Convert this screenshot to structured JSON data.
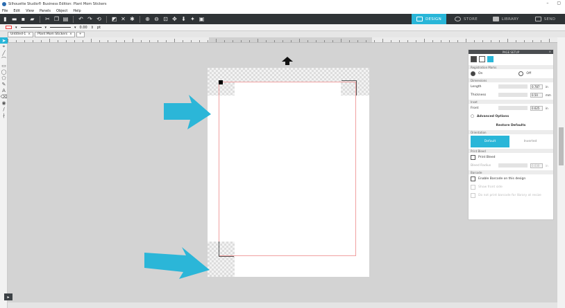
{
  "window": {
    "title": "Silhouette Studio® Business Edition: Plant Mom Stickers",
    "min": "–",
    "max": "▢",
    "close": "✕"
  },
  "menu": [
    "File",
    "Edit",
    "View",
    "Panels",
    "Object",
    "Help"
  ],
  "nav_tabs": [
    {
      "label": "DESIGN",
      "icon": "design-icon",
      "active": true
    },
    {
      "label": "STORE",
      "icon": "store-icon",
      "active": false
    },
    {
      "label": "LIBRARY",
      "icon": "library-icon",
      "active": false
    },
    {
      "label": "SEND",
      "icon": "send-icon",
      "active": false
    }
  ],
  "options_bar": {
    "line_width": "0.00",
    "unit": "pt"
  },
  "doc_tabs": [
    "Untitled-1",
    "Plant Mom Stickers"
  ],
  "page_setup": {
    "title": "PAGE SETUP",
    "sections": {
      "registration": "Registration Marks",
      "dimensions": "Dimensions",
      "inset": "Inset",
      "orientation": "Orientation",
      "print_bleed": "Print Bleed",
      "barcode": "Barcode"
    },
    "reg_on": "On",
    "reg_off": "Off",
    "length_label": "Length",
    "length_value": "0.787",
    "length_unit": "in",
    "thickness_label": "Thickness",
    "thickness_value": "0.50",
    "thickness_unit": "mm",
    "front_label": "Front",
    "front_value": "0.625",
    "front_unit": "in",
    "advanced": "Advanced Options",
    "restore": "Restore Defaults",
    "orient_default": "Default",
    "orient_inverted": "Inverted",
    "print_bleed_label": "Print Bleed",
    "bleed_radius_label": "Bleed Radius",
    "bleed_radius_value": "0.030",
    "bleed_radius_unit": "in",
    "barcode_enable": "Enable Barcode on this design",
    "barcode_both": "Show front side",
    "barcode_ex": "Do not print barcode for library at resize"
  },
  "colors": {
    "accent": "#29b6d8",
    "toolbar": "#2f3336",
    "cut_line": "#f0a0a0"
  }
}
